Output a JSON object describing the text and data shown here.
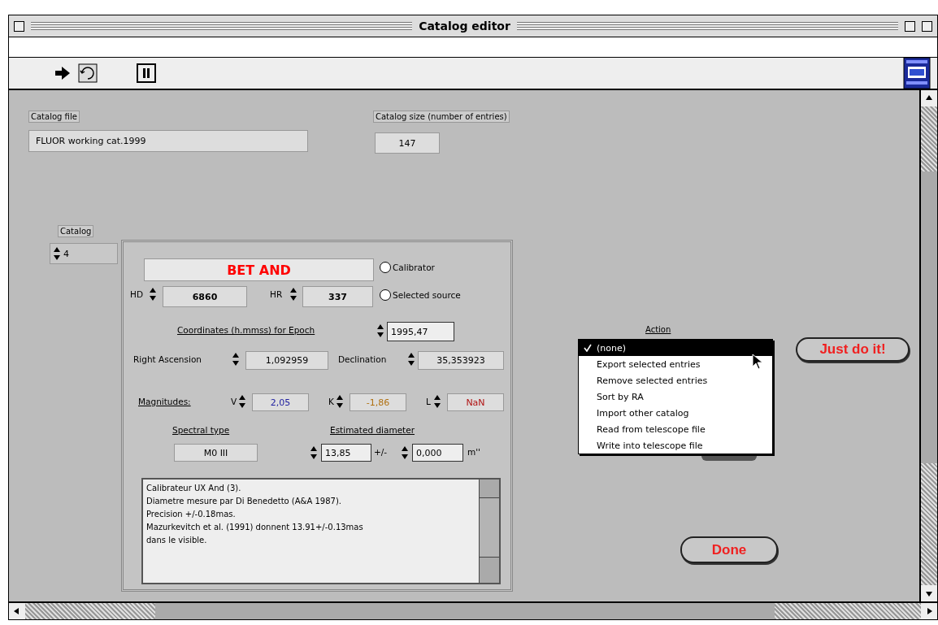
{
  "window": {
    "title": "Catalog editor"
  },
  "catalog_file": {
    "label": "Catalog file",
    "value": "FLUOR working cat.1999"
  },
  "catalog_size": {
    "label": "Catalog size (number of entries)",
    "value": "147"
  },
  "catalog": {
    "label": "Catalog",
    "value": "4"
  },
  "entry": {
    "name": "BET AND",
    "flags": [
      {
        "label": "Calibrator",
        "selected": false
      },
      {
        "label": "Selected source",
        "selected": false
      }
    ],
    "hd": {
      "label": "HD",
      "value": "6860"
    },
    "hr": {
      "label": "HR",
      "value": "337"
    },
    "coordinates": {
      "label": "Coordinates (h.mmss) for Epoch",
      "value": "1995,47"
    },
    "right_ascension": {
      "label": "Right Ascension",
      "value": "1,092959"
    },
    "declination": {
      "label": "Declination",
      "value": "35,353923"
    },
    "magnitudes": {
      "label": "Magnitudes:",
      "bands": [
        {
          "label": "V",
          "value": "2,05",
          "color": "#2020a0"
        },
        {
          "label": "K",
          "value": "-1,86",
          "color": "#b07010"
        },
        {
          "label": "L",
          "value": "NaN",
          "color": "#b01010"
        }
      ]
    },
    "spectral_type": {
      "label": "Spectral type",
      "value": "M0 III"
    },
    "diameter": {
      "label": "Estimated diameter",
      "value": "13,85",
      "separator": "+/-",
      "error": "0,000",
      "unit": "m''"
    },
    "notes": [
      "Calibrateur UX And (3).",
      "Diametre mesure par Di Benedetto (A&A 1987).",
      "Precision +/-0.18mas.",
      "Mazurkevitch et al. (1991) donnent 13.91+/-0.13mas",
      "dans le visible."
    ]
  },
  "action": {
    "label": "Action",
    "options": [
      {
        "label": "(none)",
        "selected": true
      },
      {
        "label": "Export selected entries",
        "selected": false
      },
      {
        "label": "Remove selected entries",
        "selected": false
      },
      {
        "label": "Sort by RA",
        "selected": false
      },
      {
        "label": "Import other catalog",
        "selected": false
      },
      {
        "label": "Read from telescope file",
        "selected": false
      },
      {
        "label": "Write into telescope file",
        "selected": false
      }
    ]
  },
  "buttons": [
    {
      "kind": "run",
      "label": "Just do it!"
    },
    {
      "kind": "done",
      "label": "Done"
    }
  ]
}
